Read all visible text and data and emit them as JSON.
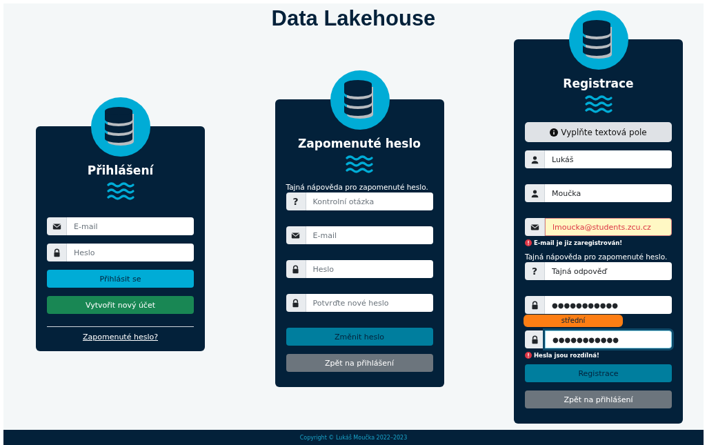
{
  "page_title": "Data Lakehouse",
  "panels": [
    {
      "title": "Přihlášení",
      "items": [
        {
          "kind": "email",
          "placeholder": "E-mail"
        },
        {
          "kind": "password",
          "placeholder": "Heslo"
        },
        {
          "kind": "login",
          "label": "Přihlásit se"
        },
        {
          "kind": "create",
          "label": "Vytvořit nový účet"
        },
        {
          "kind": "divider"
        },
        {
          "kind": "link",
          "label": "Zapomenuté heslo?"
        }
      ]
    },
    {
      "title": "Zapomenuté heslo",
      "items": [
        {
          "kind": "hint",
          "text": "Tajná nápověda pro zapomenuté heslo."
        },
        {
          "kind": "question",
          "symbol": "?",
          "placeholder": "Kontrolní otázka"
        },
        {
          "kind": "email",
          "placeholder": "E-mail"
        },
        {
          "kind": "password",
          "placeholder": "Heslo"
        },
        {
          "kind": "password",
          "placeholder": "Potvrďte nové heslo"
        },
        {
          "kind": "submit",
          "label": "Změnit heslo"
        },
        {
          "kind": "back",
          "label": "Zpět na přihlášení"
        }
      ]
    },
    {
      "title": "Registrace",
      "items": [
        {
          "kind": "alert",
          "text": "Vyplňte textová pole"
        },
        {
          "kind": "name",
          "value": "Lukáš"
        },
        {
          "kind": "name",
          "value": "Moučka"
        },
        {
          "kind": "email",
          "value": "lmoucka@students.zcu.cz",
          "invalid": true
        },
        {
          "kind": "error",
          "text": "E-mail je jiz zaregistrován!"
        },
        {
          "kind": "hint",
          "text": "Tajná nápověda pro zapomenuté heslo."
        },
        {
          "kind": "question",
          "symbol": "?",
          "value": "Tajná odpověď"
        },
        {
          "kind": "password",
          "value": "●●●●●●●●●●●"
        },
        {
          "kind": "strength",
          "label": "střední",
          "level": 0.67
        },
        {
          "kind": "password",
          "value": "●●●●●●●●●●●",
          "focused": true
        },
        {
          "kind": "error",
          "text": "Hesla jsou rozdílná!"
        },
        {
          "kind": "submit",
          "label": "Registrace"
        },
        {
          "kind": "back",
          "label": "Zpět na přihlášení"
        }
      ]
    }
  ],
  "footer": "Copyright © Lukáš Moučka 2022–2023"
}
